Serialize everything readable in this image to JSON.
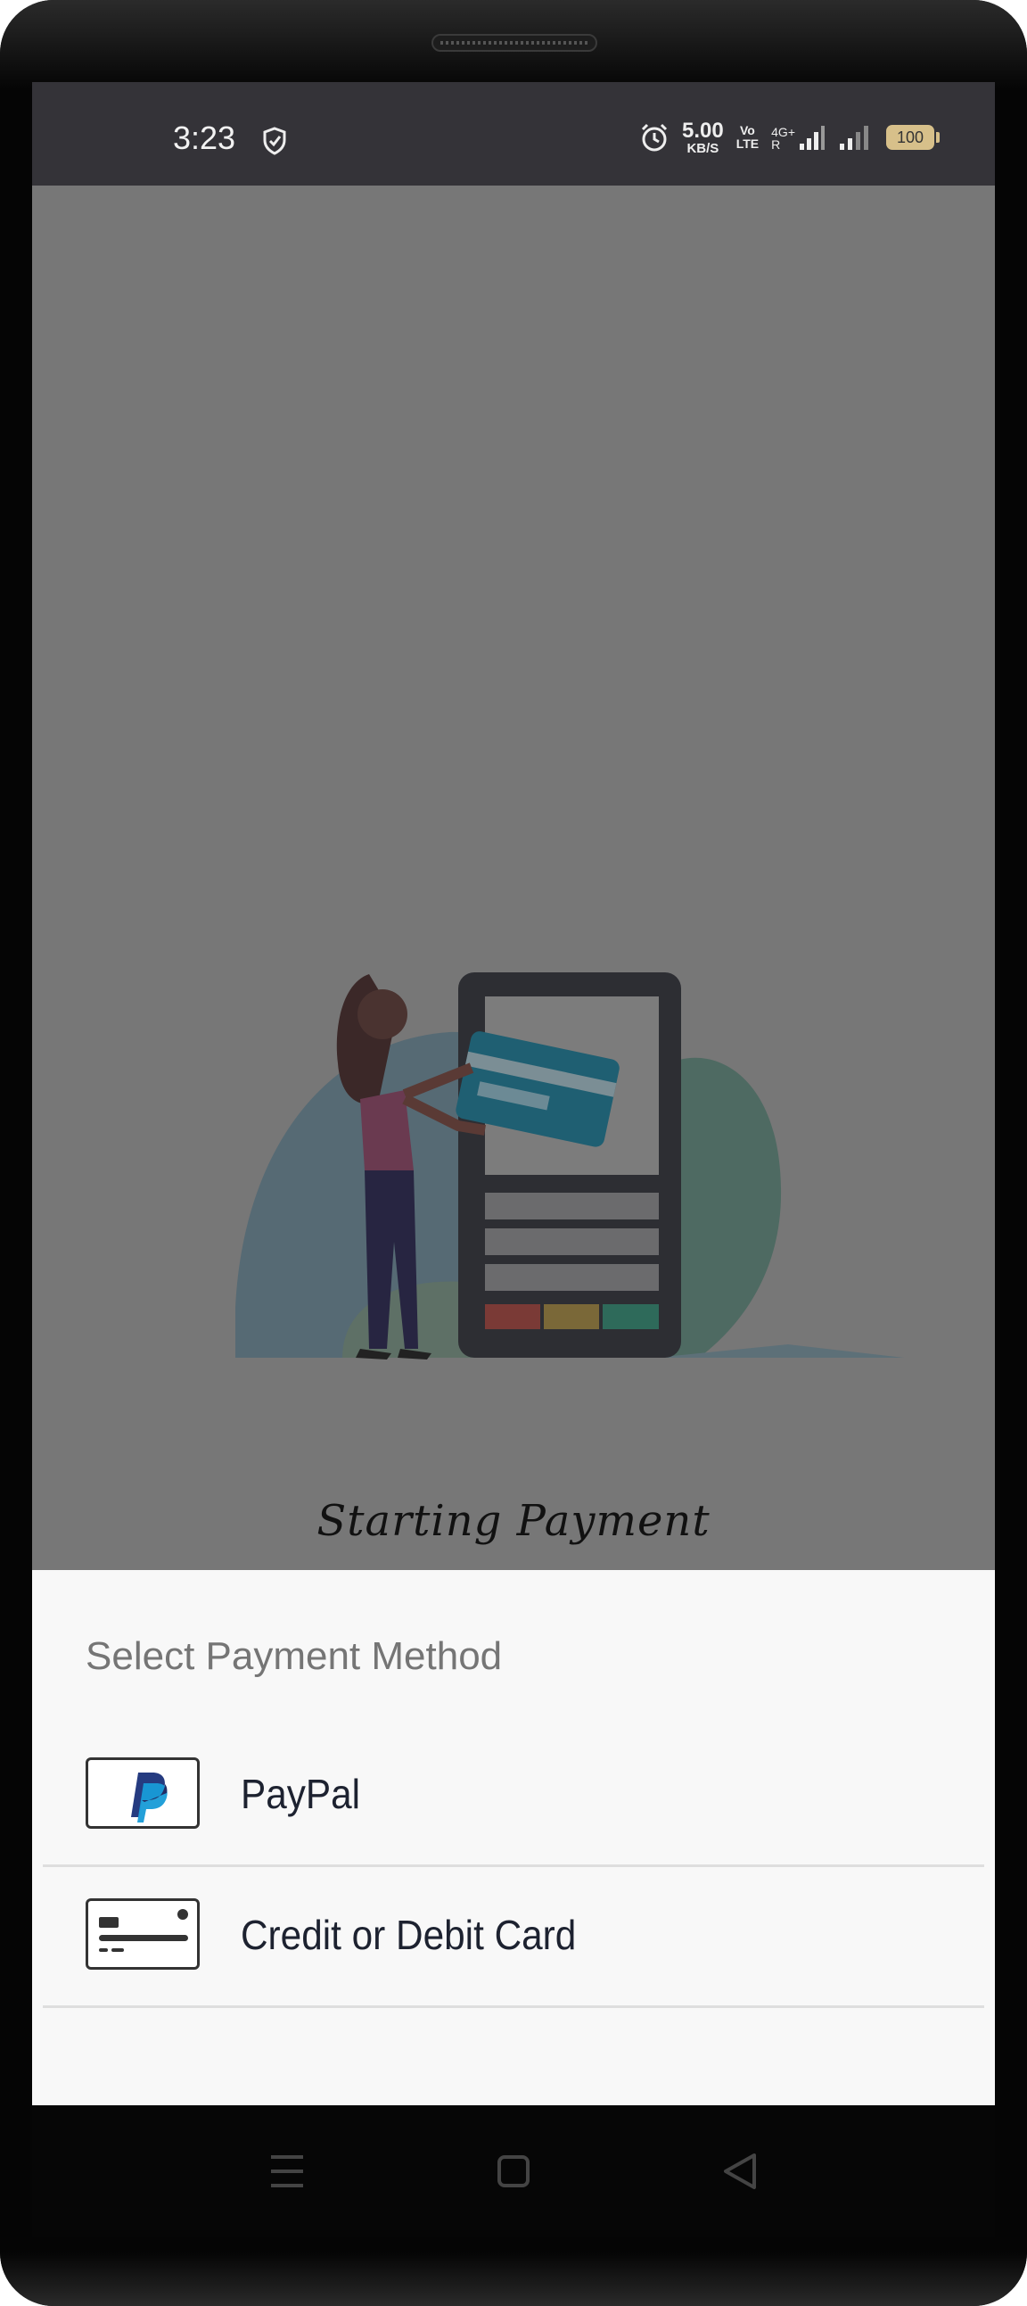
{
  "status_bar": {
    "time": "3:23",
    "network_speed_value": "5.00",
    "network_speed_unit": "KB/S",
    "volte_line1": "Vo",
    "volte_line2": "LTE",
    "network_type": "4G+",
    "roaming": "R",
    "battery_level": "100",
    "icons": [
      "shield-icon",
      "alarm-icon",
      "signal-icon",
      "battery-icon"
    ]
  },
  "main": {
    "loading_text": "Starting Payment"
  },
  "payment_sheet": {
    "title": "Select Payment Method",
    "methods": [
      {
        "label": "PayPal",
        "icon": "paypal-icon"
      },
      {
        "label": "Credit or Debit Card",
        "icon": "credit-card-icon"
      }
    ]
  },
  "nav_bar": {
    "buttons": [
      "menu-icon",
      "home-icon",
      "back-icon"
    ]
  },
  "colors": {
    "overlay": "#777777",
    "status_bar_bg": "#343338",
    "sheet_bg": "#f8f8f8",
    "paypal_dark": "#253b80",
    "paypal_light": "#179bd7"
  }
}
